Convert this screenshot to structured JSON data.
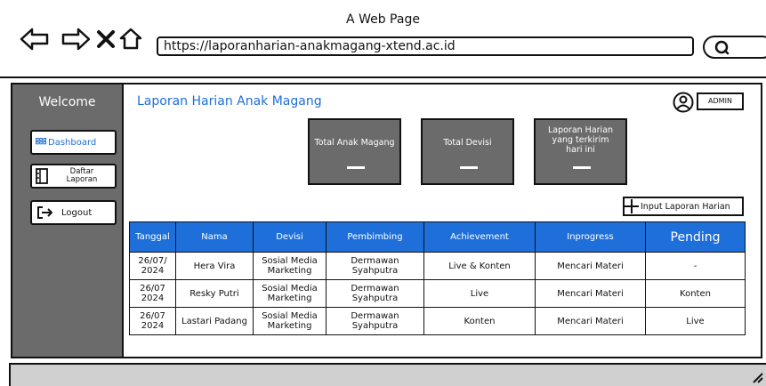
{
  "browser": {
    "title": "A Web Page",
    "url": "https://laporanharian-anakmagang-xtend.ac.id"
  },
  "sidebar": {
    "welcome": "Welcome",
    "items": [
      {
        "label": "Dashboard",
        "icon": "grid-icon",
        "active": true
      },
      {
        "label": "Daftar Laporan",
        "icon": "book-icon",
        "active": false
      },
      {
        "label": "Logout",
        "icon": "logout-icon",
        "active": false
      }
    ],
    "label_daftar_1": "Daftar",
    "label_daftar_2": "Laporan"
  },
  "main": {
    "title": "Laporan Harian Anak Magang",
    "user": {
      "badge": "ADMIN"
    },
    "cards": [
      {
        "label": "Total Anak Magang"
      },
      {
        "label": "Total Devisi"
      },
      {
        "label": "Laporan Harian yang terkirim hari ini"
      }
    ],
    "input_button": "Input Laporan Harian",
    "table": {
      "headers": [
        "Tanggal",
        "Nama",
        "Devisi",
        "Pembimbing",
        "Achievement",
        "Inprogress",
        "Pending"
      ],
      "rows": [
        [
          "26/07/ 2024",
          "Hera Vira",
          "Sosial Media Marketing",
          "Dermawan Syahputra",
          "Live & Konten",
          "Mencari Materi",
          "-"
        ],
        [
          "26/07 2024",
          "Resky Putri",
          "Sosial Media Marketing",
          "Dermawan Syahputra",
          "Live",
          "Mencari Materi",
          "Konten"
        ],
        [
          "26/07 2024",
          "Lastari Padang",
          "Sosial Media Marketing",
          "Dermawan Syahputra",
          "Konten",
          "Mencari Materi",
          "Live"
        ]
      ]
    }
  },
  "colors": {
    "accent": "#1e6fd9",
    "sidebar": "#6b6b6b",
    "card": "#6b6b6b"
  }
}
